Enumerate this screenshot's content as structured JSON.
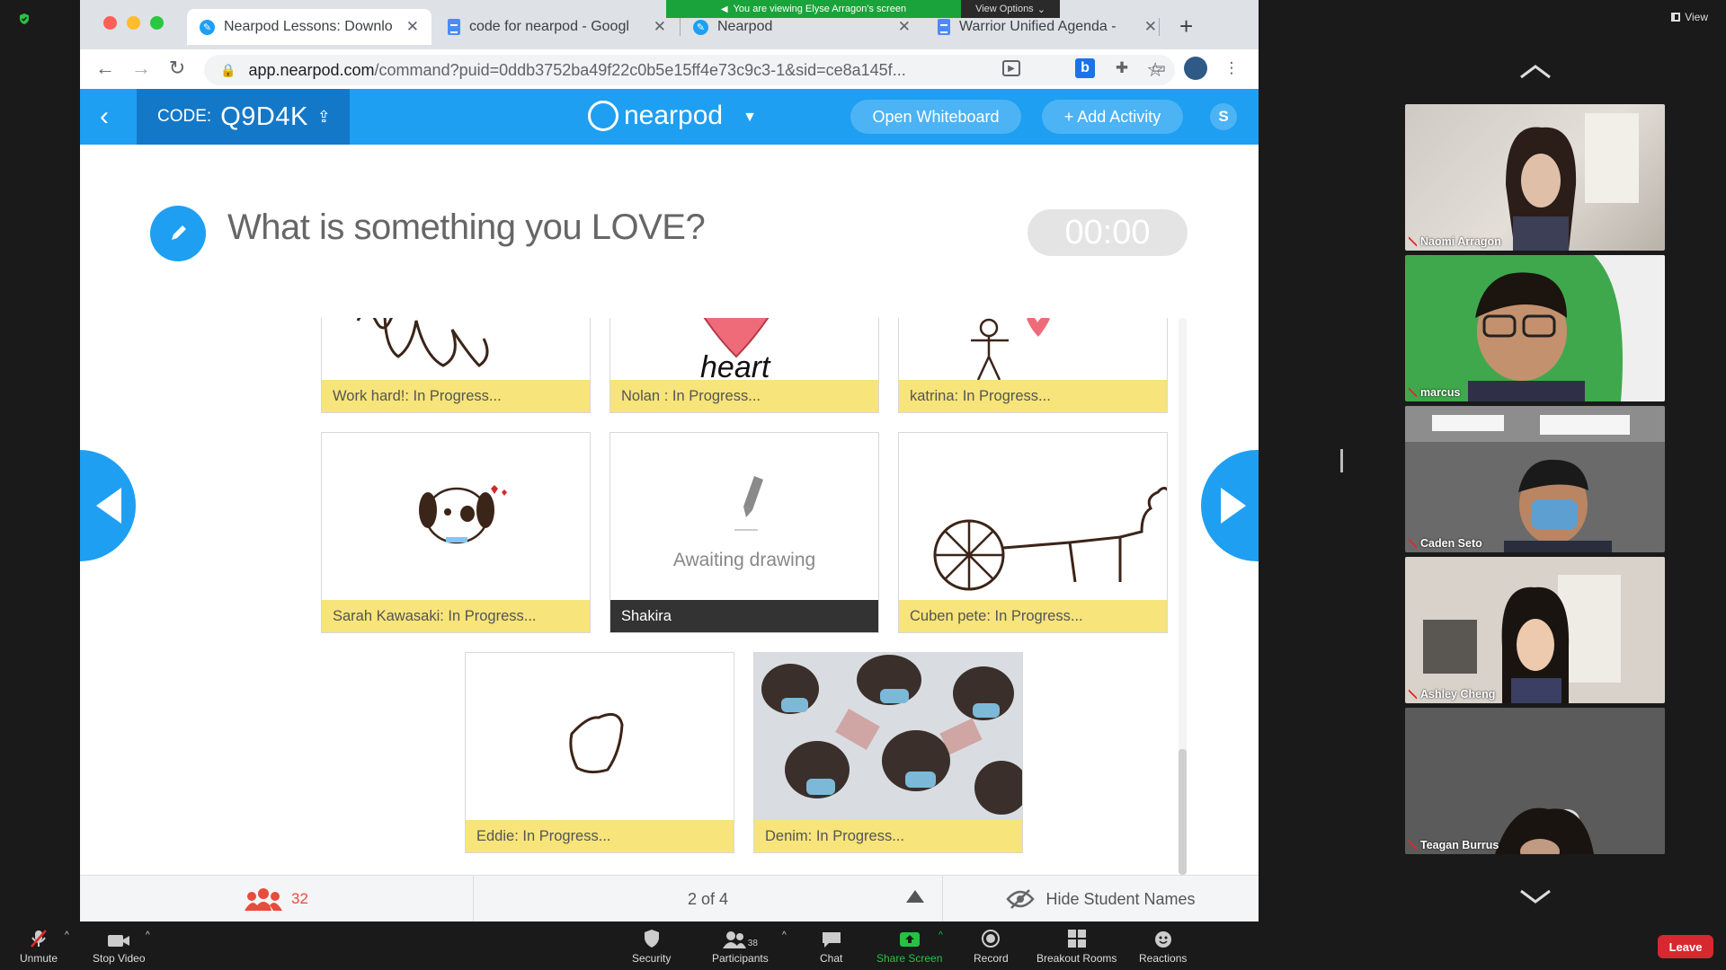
{
  "zoom": {
    "banner_text": "You are viewing Elyse Arragon's screen",
    "view_options": "View Options",
    "view_label": "View",
    "participant_count": "38",
    "toolbar": [
      {
        "label": "Unmute",
        "icon": "mic-muted-icon"
      },
      {
        "label": "Stop Video",
        "icon": "video-icon"
      },
      {
        "label": "Security",
        "icon": "shield-icon"
      },
      {
        "label": "Participants",
        "icon": "participants-icon"
      },
      {
        "label": "Chat",
        "icon": "chat-icon"
      },
      {
        "label": "Share Screen",
        "icon": "share-screen-icon"
      },
      {
        "label": "Record",
        "icon": "record-icon"
      },
      {
        "label": "Breakout Rooms",
        "icon": "breakout-rooms-icon"
      },
      {
        "label": "Reactions",
        "icon": "reactions-icon"
      }
    ],
    "leave_label": "Leave",
    "participants": [
      {
        "name": "Naomi Arragon"
      },
      {
        "name": "marcus"
      },
      {
        "name": "Caden Seto"
      },
      {
        "name": "Ashley Cheng"
      },
      {
        "name": "Teagan Burrus"
      }
    ]
  },
  "browser": {
    "tabs": [
      {
        "title": "Nearpod Lessons: Downlo",
        "icon": "nearpod-icon",
        "active": true
      },
      {
        "title": "code for nearpod - Googl",
        "icon": "docs-icon",
        "active": false
      },
      {
        "title": "Nearpod",
        "icon": "nearpod-icon",
        "active": false
      },
      {
        "title": "Warrior Unified Agenda -",
        "icon": "docs-icon",
        "active": false
      }
    ],
    "url_host": "app.nearpod.com",
    "url_path": "/command?puid=0ddb3752ba49f22c0b5e15ff4e73c9c3-1&sid=ce8a145f..."
  },
  "nearpod": {
    "code_label": "CODE:",
    "code_value": "Q9D4K",
    "logo_text": "nearpod",
    "open_whiteboard": "Open Whiteboard",
    "add_activity": "+ Add Activity",
    "s_badge": "S",
    "question": "What is something you LOVE?",
    "timer": "00:00",
    "submissions": [
      {
        "label": "Work hard!: In Progress..."
      },
      {
        "label": "Nolan : In Progress..."
      },
      {
        "label": "katrina: In Progress..."
      },
      {
        "label": "Sarah Kawasaki: In Progress..."
      },
      {
        "label": "Shakira",
        "awaiting": "Awaiting drawing"
      },
      {
        "label": "Cuben pete: In Progress..."
      },
      {
        "label": "Eddie: In Progress..."
      },
      {
        "label": "Denim: In Progress..."
      }
    ],
    "drawing_text": "heart",
    "student_count": "32",
    "page_indicator": "2 of 4",
    "hide_names": "Hide Student Names"
  },
  "colors": {
    "nearpod_blue": "#1e9ff2",
    "label_yellow": "#f7e47a",
    "zoom_green": "#1aa33a",
    "leave_red": "#d7282f"
  }
}
